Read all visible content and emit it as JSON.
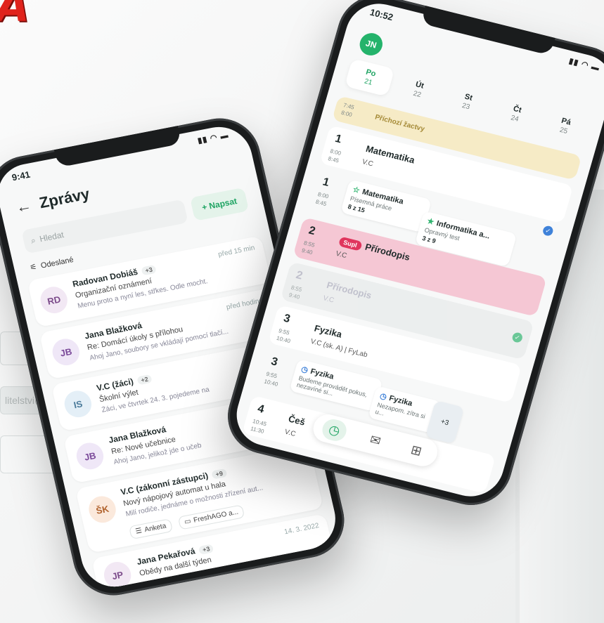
{
  "background": {
    "red_letter": "A",
    "red_marks": "!!",
    "email_fragment": "litelstvi@"
  },
  "left_phone": {
    "status_time": "9:41",
    "status_icons": "signal-wifi-battery",
    "title": "Zprávy",
    "search_placeholder": "Hledat",
    "write_label": "+ Napsat",
    "filter_label": "Odeslané",
    "messages": [
      {
        "initials": "RD",
        "name": "Radovan Dobiáš",
        "badge": "+3",
        "time": "před 15 min",
        "subject": "Organizační oznámení",
        "preview": "Menu proto a nyní les, střkes. Odle mocht.",
        "color": "#f2e8f4",
        "text_color": "#7b4a8a"
      },
      {
        "initials": "JB",
        "name": "Jana Blažková",
        "badge": "",
        "time": "před hodinou",
        "subject": "Re: Domácí úkoly s přílohou",
        "preview": "Ahoj Jano, soubory se vkládají pomocí tlačí...",
        "color": "#efe7f7",
        "text_color": "#7b4a9a"
      },
      {
        "initials": "IS",
        "name": "V.C (žáci)",
        "badge": "+2",
        "time": "",
        "subject": "Školní výlet",
        "preview": "Žáci, ve čtvrtek 24. 3. pojedeme na",
        "color": "#e4eff7",
        "text_color": "#4a7a9a"
      },
      {
        "initials": "JB",
        "name": "Jana Blažková",
        "badge": "",
        "time": "",
        "subject": "Re: Nové učebnice",
        "preview": "Ahoj Jano, jelikož jde o učeb",
        "color": "#efe7f7",
        "text_color": "#7b4a9a"
      },
      {
        "initials": "ŠK",
        "name": "V.C (zákonní zástupci)",
        "badge": "+9",
        "time": "",
        "subject": "Nový nápojový automat u hala",
        "preview": "Milí rodiče, jednáme o možnosti zřízení aut...",
        "color": "#fbe9dc",
        "text_color": "#b0602a",
        "chips": [
          "Anketa",
          "FreshAGO a..."
        ]
      },
      {
        "initials": "JP",
        "name": "Jana Pekařová",
        "badge": "+3",
        "time": "14. 3. 2022",
        "subject": "Obědy na další týden",
        "preview": "",
        "color": "#f2e8f4",
        "text_color": "#7b4a8a"
      }
    ]
  },
  "right_phone": {
    "status_time": "10:52",
    "user_initials": "JN",
    "days": [
      {
        "d": "Po",
        "n": "21",
        "active": true
      },
      {
        "d": "Út",
        "n": "22",
        "active": false
      },
      {
        "d": "St",
        "n": "23",
        "active": false
      },
      {
        "d": "Čt",
        "n": "24",
        "active": false
      },
      {
        "d": "Pá",
        "n": "25",
        "active": false
      }
    ],
    "event": {
      "time1": "7:45",
      "time2": "8:00",
      "label": "Příchozí žactvy"
    },
    "lessons": [
      {
        "num": "1",
        "t1": "8:00",
        "t2": "8:45",
        "subject": "Matematika",
        "teacher": "V.C"
      },
      {
        "num": "2",
        "t1": "8:55",
        "t2": "9:40",
        "subject": "Přírodopis",
        "teacher": "V.C",
        "tag": "Supl"
      },
      {
        "num": "2",
        "t1": "8:55",
        "t2": "9:40",
        "subject": "Přírodopis",
        "teacher": "V.C"
      },
      {
        "num": "3",
        "t1": "9:55",
        "t2": "10:40",
        "subject": "Fyzika",
        "teacher": "V.C (sk. A) | FyLab"
      },
      {
        "num": "4",
        "t1": "10:45",
        "t2": "11:30",
        "subject": "Češ",
        "teacher": "V.C"
      }
    ],
    "cards": {
      "math": {
        "title": "Matematika",
        "sub": "Písemná práce",
        "grade": "8 z 15"
      },
      "info": {
        "title": "Informatika a...",
        "sub": "Opravný test",
        "grade": "3 z 9"
      },
      "phys1": {
        "title": "Fyzika",
        "sub": "Budeme provádět pokus, nezavíné si..."
      },
      "phys2": {
        "title": "Fyzika",
        "sub": "Nezapom. zítra si u..."
      },
      "more": "+3",
      "lesson1_num": "1",
      "lesson1_t1": "8:00",
      "lesson1_t2": "8:45",
      "lesson3_num": "3",
      "lesson3_t1": "9:55",
      "lesson3_t2": "10:40"
    },
    "nav": [
      "clock-icon",
      "mail-icon",
      "grid-icon"
    ]
  }
}
